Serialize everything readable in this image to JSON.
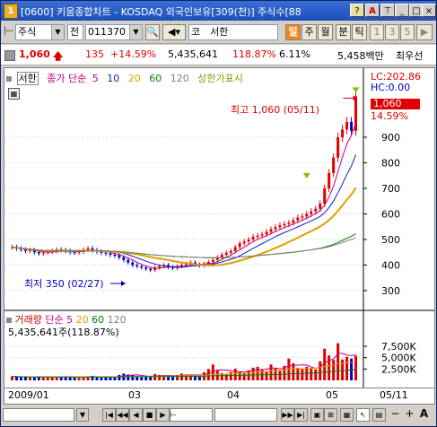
{
  "window": {
    "badge": "1",
    "title": "[0600] 키움종합차트 - KOSDAQ 외국인보유[309(천)] 주식수[88",
    "btn_min": "_",
    "btn_max": "□",
    "btn_close": "×"
  },
  "toolbar": {
    "market": "주식",
    "range": "전",
    "code": "011370",
    "name_prefix": "코",
    "name": "서한",
    "periods": [
      "일",
      "주",
      "월",
      "분",
      "틱"
    ],
    "selected_period": "일",
    "minutes": [
      "1",
      "3",
      "5"
    ]
  },
  "price": {
    "current": "1,060",
    "change": "135",
    "change_pct": "+14.59%",
    "volume": "5,435,641",
    "vol_ratio": "118.87%",
    "turnover": "6.11%",
    "amount": "5,458백만",
    "pref": "최우선"
  },
  "chart_data": [
    {
      "type": "candlestick",
      "legend": {
        "stock": "서한",
        "ma_label": "종가 단순",
        "periods": [
          "5",
          "10",
          "20",
          "60",
          "120"
        ],
        "limit_label": "상한가표시"
      },
      "y_ticks": [
        300,
        400,
        500,
        600,
        700,
        800,
        900
      ],
      "ylim": [
        240,
        1100
      ],
      "lc": "LC:202.86",
      "hc": "HC:0.00",
      "price_tag": "1,060",
      "pct_tag": "14.59%",
      "high_note": "최고 1,060 (05/11)",
      "low_note": "최저 350 (02/27)",
      "closes": [
        470,
        465,
        460,
        455,
        458,
        450,
        445,
        448,
        452,
        455,
        460,
        458,
        455,
        450,
        448,
        452,
        460,
        465,
        458,
        452,
        448,
        445,
        440,
        438,
        430,
        420,
        410,
        400,
        395,
        390,
        385,
        380,
        390,
        395,
        400,
        392,
        388,
        395,
        400,
        405,
        410,
        402,
        398,
        405,
        412,
        420,
        430,
        440,
        448,
        455,
        470,
        485,
        492,
        500,
        510,
        515,
        520,
        530,
        540,
        548,
        555,
        560,
        565,
        575,
        585,
        590,
        600,
        610,
        620,
        640,
        700,
        760,
        820,
        900,
        930,
        960,
        925,
        1060
      ]
    },
    {
      "type": "bar",
      "legend": {
        "label": "거래량",
        "ma_label": "단순",
        "periods": [
          "5",
          "20",
          "60",
          "120"
        ]
      },
      "volume_text": "5,435,641주(118.87%)",
      "y_ticks": [
        "7,500K",
        "5,000K",
        "2,500K"
      ],
      "ylim": [
        0,
        9500
      ],
      "volumes_k": [
        900,
        800,
        700,
        750,
        600,
        650,
        900,
        800,
        700,
        650,
        700,
        800,
        900,
        750,
        600,
        550,
        700,
        900,
        1000,
        800,
        600,
        700,
        650,
        800,
        1200,
        1500,
        1300,
        1100,
        900,
        700,
        800,
        1000,
        1400,
        1200,
        900,
        800,
        1000,
        1200,
        1500,
        1300,
        1000,
        900,
        1200,
        1800,
        2500,
        3500,
        2200,
        1600,
        1400,
        1800,
        2600,
        2000,
        1500,
        2200,
        2800,
        3000,
        2400,
        2000,
        3500,
        2600,
        2200,
        3200,
        4800,
        3800,
        2800,
        2500,
        3000,
        2600,
        2400,
        4200,
        7000,
        5500,
        4500,
        8200,
        4600,
        5200,
        4800,
        5435
      ]
    }
  ],
  "dates": [
    "2009/01",
    "03",
    "04",
    "05",
    "05/11"
  ],
  "bottom": [
    "|◀",
    "◀◀",
    "◀",
    "■",
    "▶",
    "▶▶",
    "▶|",
    "−",
    "+",
    "A"
  ]
}
